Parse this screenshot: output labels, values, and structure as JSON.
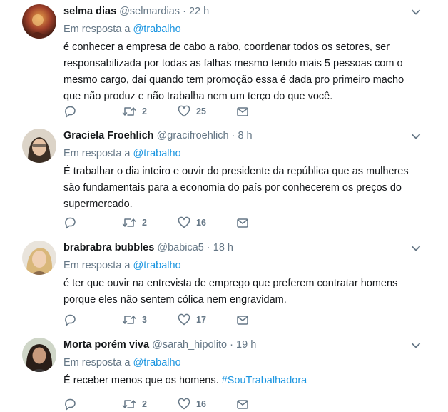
{
  "tweets": [
    {
      "name": "selma dias",
      "handle": "@selmardias",
      "separator": "·",
      "time": "22 h",
      "reply_prefix": "Em resposta a",
      "reply_to": "@trabalho",
      "text": "é conhecer a empresa de cabo a rabo, coordenar todos os setores, ser responsabilizada por todas as falhas mesmo tendo mais 5 pessoas com o mesmo cargo, daí quando tem promoção essa é dada pro primeiro macho que não produz e não trabalha nem um terço do que você.",
      "hashtag": "",
      "retweets": "2",
      "likes": "25"
    },
    {
      "name": "Graciela Froehlich",
      "handle": "@gracifroehlich",
      "separator": "·",
      "time": "8 h",
      "reply_prefix": "Em resposta a",
      "reply_to": "@trabalho",
      "text": "É trabalhar o dia inteiro e ouvir do presidente da república que as mulheres são fundamentais para a economia do país por conhecerem os preços do supermercado.",
      "hashtag": "",
      "retweets": "2",
      "likes": "16"
    },
    {
      "name": "brabrabra bubbles",
      "handle": "@babica5",
      "separator": "·",
      "time": "18 h",
      "reply_prefix": "Em resposta a",
      "reply_to": "@trabalho",
      "text": "é ter que ouvir na entrevista de emprego que preferem contratar homens porque eles não sentem cólica nem engravidam.",
      "hashtag": "",
      "retweets": "3",
      "likes": "17"
    },
    {
      "name": "Morta porém viva",
      "handle": "@sarah_hipolito",
      "separator": "·",
      "time": "19 h",
      "reply_prefix": "Em resposta a",
      "reply_to": "@trabalho",
      "text": "É receber menos que os homens.",
      "hashtag": "#SouTrabalhadora",
      "retweets": "2",
      "likes": "16"
    }
  ],
  "colors": {
    "link": "#1b95e0",
    "muted": "#657786",
    "text": "#14171a",
    "divider": "#e6ecf0"
  },
  "icons": [
    "reply-icon",
    "retweet-icon",
    "like-icon",
    "direct-message-icon",
    "chevron-down-icon"
  ]
}
